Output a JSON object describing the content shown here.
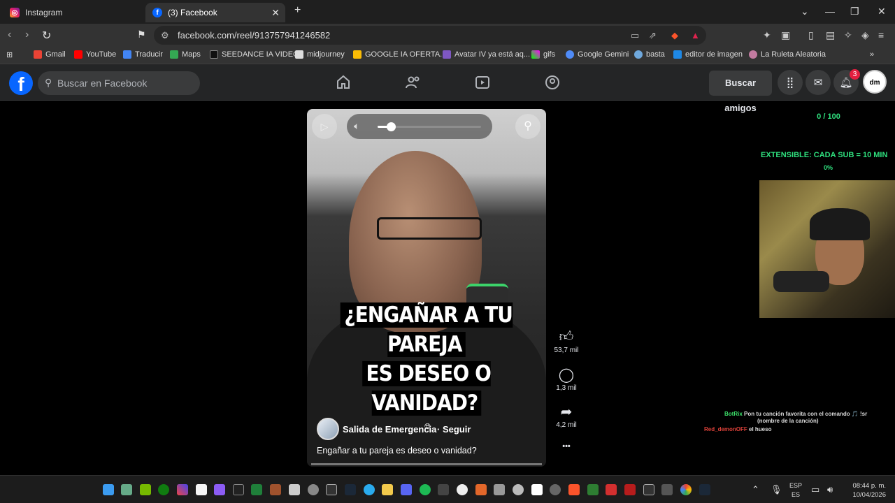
{
  "browser": {
    "tabs": [
      {
        "title": "Instagram",
        "active": false
      },
      {
        "title": "(3) Facebook",
        "active": true
      }
    ],
    "new_tab": "+",
    "url": "facebook.com/reel/913757941246582",
    "bookmarks": [
      "Gmail",
      "YouTube",
      "Traducir",
      "Maps",
      "SEEDANCE IA VIDEO",
      "midjourney",
      "GOOGLE IA OFERTA...",
      "Avatar IV ya está aq...",
      "gifs",
      "Google Gemini",
      "basta",
      "editor de imagen",
      "La Ruleta Aleatoria"
    ]
  },
  "facebook": {
    "logo": "f",
    "search_placeholder": "Buscar en Facebook",
    "find_friends": "Buscar amigos",
    "notifications_count": "3",
    "profile_initials": "dm",
    "brand_color": "#0866ff"
  },
  "reel": {
    "caption_line1": "¿ENGAÑAR A TU PAREJA",
    "caption_line2": "ES DESEO O VANIDAD?",
    "author": "Salida de Emergencia",
    "follow": "· Seguir",
    "description": "Engañar a tu pareja es deseo o vanidad?",
    "volume_level": 0.13,
    "likes": "53,7 mil",
    "comments": "1,3 mil",
    "shares": "4,2 mil",
    "more": "•••"
  },
  "overlay": {
    "goal": "0 / 100",
    "extensible": "EXTENSIBLE: CADA SUB = 10 MIN",
    "percent": "0%",
    "chat": [
      {
        "user": "BotRix",
        "message": "Pon tu canción favorita con el comando 🎵 !sr",
        "message2": "(nombre de la canción)"
      },
      {
        "user": "Red_demonOFF",
        "message": "el hueso"
      }
    ]
  },
  "taskbar": {
    "lang_line1": "ESP",
    "lang_line2": "ES",
    "time": "08:44 p. m.",
    "date": "10/04/2026"
  }
}
